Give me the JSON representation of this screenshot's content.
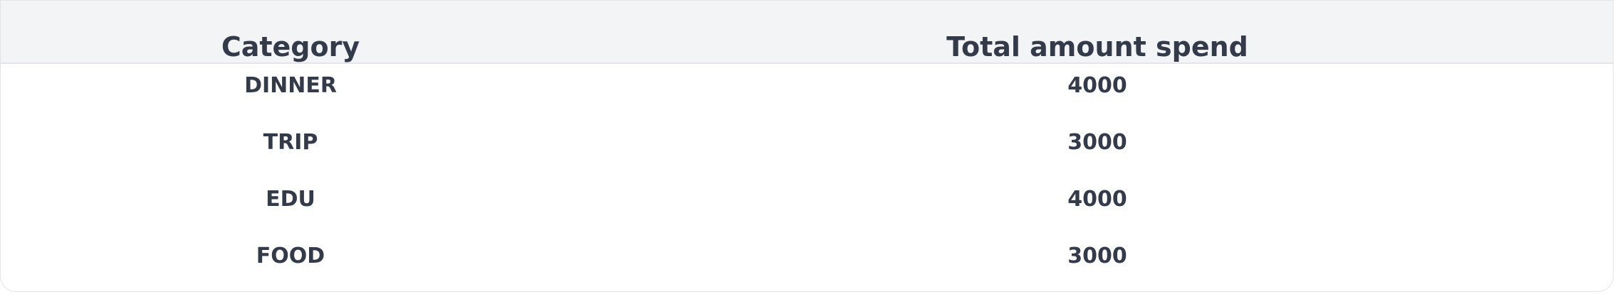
{
  "table": {
    "headers": {
      "category": "Category",
      "amount": "Total amount spend"
    },
    "rows": [
      {
        "category": "DINNER",
        "amount": "4000"
      },
      {
        "category": "TRIP",
        "amount": "3000"
      },
      {
        "category": "EDU",
        "amount": "4000"
      },
      {
        "category": "FOOD",
        "amount": "3000"
      }
    ]
  }
}
